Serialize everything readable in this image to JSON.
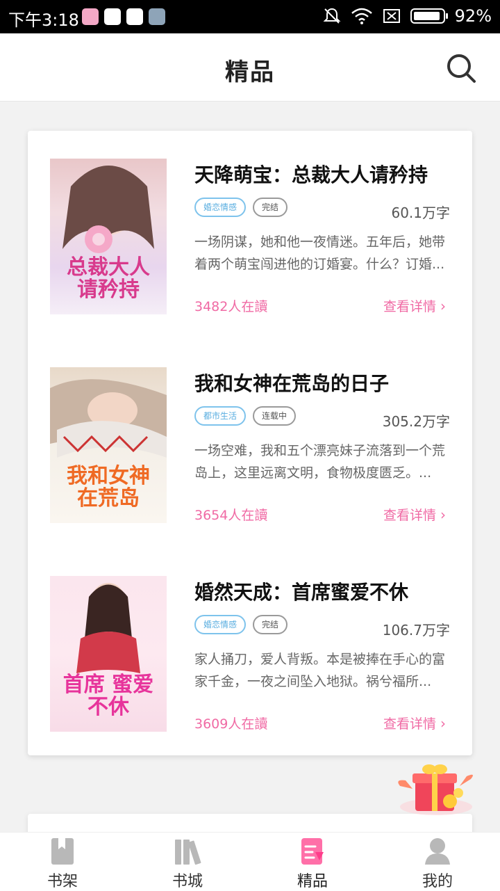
{
  "status_bar": {
    "time": "下午3:18",
    "battery": "92%",
    "battery_level": 0.92
  },
  "header": {
    "title": "精品",
    "search_icon": "search-icon"
  },
  "books": [
    {
      "title": "天降萌宝：总裁大人请矜持",
      "genre": "婚恋情感",
      "status": "完结",
      "words": "60.1万字",
      "desc": "一场阴谋，她和他一夜情迷。五年后，她带着两个萌宝闯进他的订婚宴。什么？订婚...",
      "readers": "3482人在讀",
      "detail": "查看详情",
      "cover_text": "总裁大人 请矜持",
      "cover_color": "#d83a8c"
    },
    {
      "title": "我和女神在荒岛的日子",
      "genre": "都市生活",
      "status": "连载中",
      "words": "305.2万字",
      "desc": "一场空难，我和五个漂亮妹子流落到一个荒岛上，这里远离文明，食物极度匮乏。...",
      "readers": "3654人在讀",
      "detail": "查看详情",
      "cover_text": "我和女神 在荒岛",
      "cover_color": "#ef6a24"
    },
    {
      "title": "婚然天成：首席蜜爱不休",
      "genre": "婚恋情感",
      "status": "完结",
      "words": "106.7万字",
      "desc": "家人捅刀，爱人背叛。本是被捧在手心的富家千金，一夜之间坠入地狱。祸兮福所...",
      "readers": "3609人在讀",
      "detail": "查看详情",
      "cover_text": "首席 蜜爱不休",
      "cover_color": "#e7349b"
    }
  ],
  "tabs": [
    {
      "label": "书架",
      "icon": "bookshelf-icon",
      "active": false
    },
    {
      "label": "书城",
      "icon": "bookstore-icon",
      "active": false
    },
    {
      "label": "精品",
      "icon": "featured-icon",
      "active": true
    },
    {
      "label": "我的",
      "icon": "profile-icon",
      "active": false
    }
  ],
  "colors": {
    "accent": "#f06aa4",
    "genre_tag": "#5aaee0"
  }
}
